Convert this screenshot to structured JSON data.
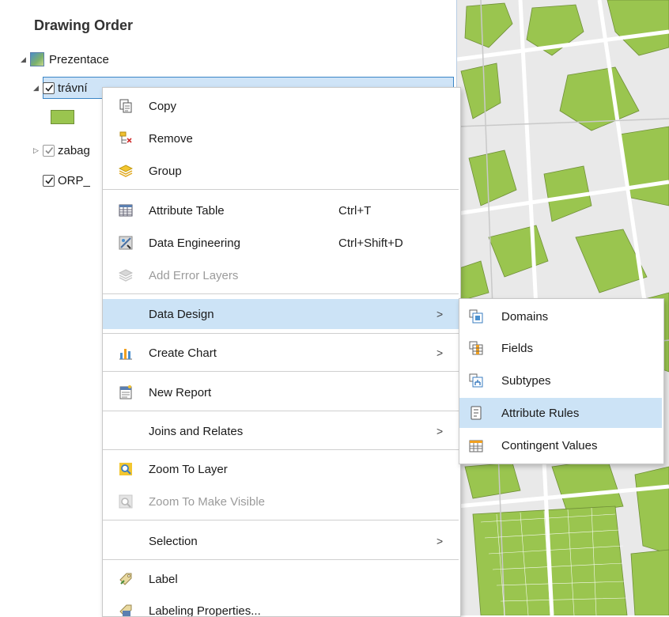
{
  "pane": {
    "title": "Drawing Order",
    "layers": [
      {
        "label": "Prezentace"
      },
      {
        "label": "trávní"
      },
      {
        "label": "zabag"
      },
      {
        "label": "ORP_"
      }
    ]
  },
  "menu": {
    "items": [
      {
        "label": "Copy",
        "icon": "copy-icon"
      },
      {
        "label": "Remove",
        "icon": "remove-icon"
      },
      {
        "label": "Group",
        "icon": "group-icon"
      },
      {
        "label": "Attribute Table",
        "shortcut": "Ctrl+T",
        "icon": "table-icon"
      },
      {
        "label": "Data Engineering",
        "shortcut": "Ctrl+Shift+D",
        "icon": "data-engineering-icon"
      },
      {
        "label": "Add Error Layers",
        "icon": "error-layers-icon",
        "disabled": true
      },
      {
        "label": "Data Design",
        "submenu": true,
        "highlighted": true
      },
      {
        "label": "Create Chart",
        "submenu": true,
        "icon": "chart-icon"
      },
      {
        "label": "New Report",
        "icon": "report-icon"
      },
      {
        "label": "Joins and Relates",
        "submenu": true
      },
      {
        "label": "Zoom To Layer",
        "icon": "zoom-layer-icon"
      },
      {
        "label": "Zoom To Make Visible",
        "icon": "zoom-visible-icon",
        "disabled": true
      },
      {
        "label": "Selection",
        "submenu": true
      },
      {
        "label": "Label",
        "icon": "label-icon"
      },
      {
        "label": "Labeling Properties...",
        "icon": "labeling-properties-icon"
      }
    ],
    "submenu_arrow": ">"
  },
  "submenu": {
    "items": [
      {
        "label": "Domains",
        "icon": "domains-icon"
      },
      {
        "label": "Fields",
        "icon": "fields-icon"
      },
      {
        "label": "Subtypes",
        "icon": "subtypes-icon"
      },
      {
        "label": "Attribute Rules",
        "icon": "attribute-rules-icon",
        "highlighted": true
      },
      {
        "label": "Contingent Values",
        "icon": "contingent-values-icon"
      }
    ]
  },
  "colors": {
    "highlight": "#cce3f6",
    "selection_border": "#3b86c6",
    "map_green": "#9ac54f",
    "map_bg": "#e9e9e9"
  }
}
